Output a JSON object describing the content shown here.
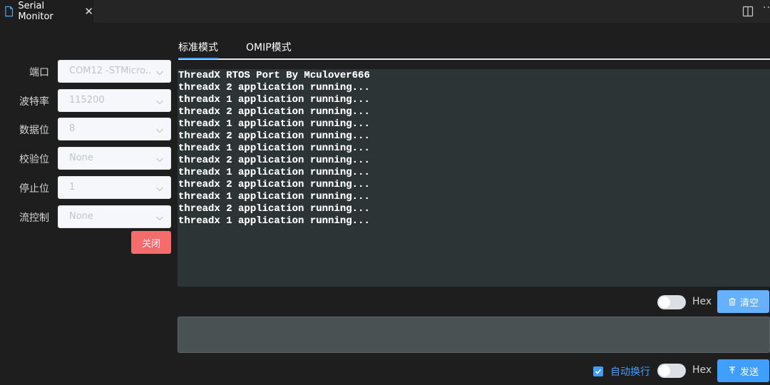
{
  "tab": {
    "title": "Serial Monitor",
    "close_glyph": "✕",
    "more_glyph": "···"
  },
  "settings": [
    {
      "label": "端口",
      "value": "COM12 -STMicro..."
    },
    {
      "label": "波特率",
      "value": "115200"
    },
    {
      "label": "数据位",
      "value": "8"
    },
    {
      "label": "校验位",
      "value": "None"
    },
    {
      "label": "停止位",
      "value": "1"
    },
    {
      "label": "流控制",
      "value": "None"
    }
  ],
  "close_button": "关闭",
  "mode_tabs": [
    "标准模式",
    "OMIP模式"
  ],
  "output_lines": [
    "ThreadX RTOS Port By Mculover666",
    "threadx 2 application running...",
    "threadx 1 application running...",
    "threadx 2 application running...",
    "threadx 1 application running...",
    "threadx 2 application running...",
    "threadx 1 application running...",
    "threadx 2 application running...",
    "threadx 1 application running...",
    "threadx 2 application running...",
    "threadx 1 application running...",
    "threadx 2 application running...",
    "threadx 1 application running..."
  ],
  "output_controls": {
    "hex_label": "Hex",
    "hex_enabled": false,
    "clear_label": "清空"
  },
  "input": {
    "value": "",
    "placeholder": ""
  },
  "input_controls": {
    "auto_newline_label": "自动换行",
    "auto_newline_checked": true,
    "hex_label": "Hex",
    "hex_enabled": false,
    "send_label": "发送"
  },
  "colors": {
    "accent": "#409eff",
    "danger": "#f56c6c",
    "console_bg": "#2d3436"
  }
}
